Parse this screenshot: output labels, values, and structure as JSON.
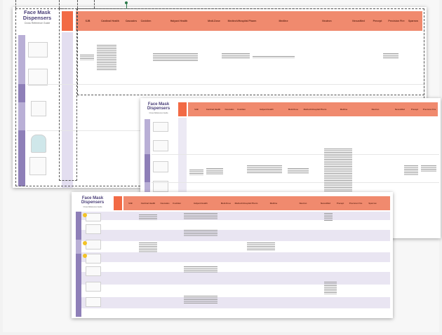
{
  "guide": {
    "title": "Face Mask Dispensers",
    "subtitle": "Cross Reference Guide"
  },
  "columns": [
    "SJB",
    "Cardinal Health",
    "Cascades",
    "Covidien",
    "Halyard Health",
    "Medi-Dose",
    "Medtech/Hospital Pharm",
    "Medline",
    "Neutron",
    "NexusMed",
    "Precept",
    "Precision Fire",
    "Sparrow"
  ],
  "colors": {
    "header": "#f08a6e",
    "key": "#f26a45",
    "title": "#4a3f78",
    "category_band": "#8e7fb8",
    "row_stripe": "#e9e5f2"
  },
  "sheet1": {
    "columns": [
      "SJB",
      "Cardinal Health",
      "Cascades",
      "Covidien",
      "Halyard Health",
      "Medi-Dose",
      "Medtech/Hospital Pharm",
      "Medline",
      "Neutron",
      "NexusMed",
      "Precept",
      "Precision Fire",
      "Sparrow"
    ]
  },
  "sheet2": {
    "columns": [
      "SJB",
      "Cardinal Health",
      "Cascades",
      "Covidien",
      "Halyard Health",
      "Medi-Dose",
      "Medtech/Hospital Pharm",
      "Medline",
      "Neutron",
      "NexusMed",
      "Precept",
      "Precision Fire"
    ]
  },
  "sheet3": {
    "columns": [
      "SJB",
      "Cardinal Health",
      "Cascades",
      "Covidien",
      "Halyard Health",
      "Medi-Dose",
      "Medtech/Hospital Pharm",
      "Medline",
      "Neutron",
      "NexusMed",
      "Precept",
      "Precision Fire",
      "Sparrow"
    ]
  }
}
